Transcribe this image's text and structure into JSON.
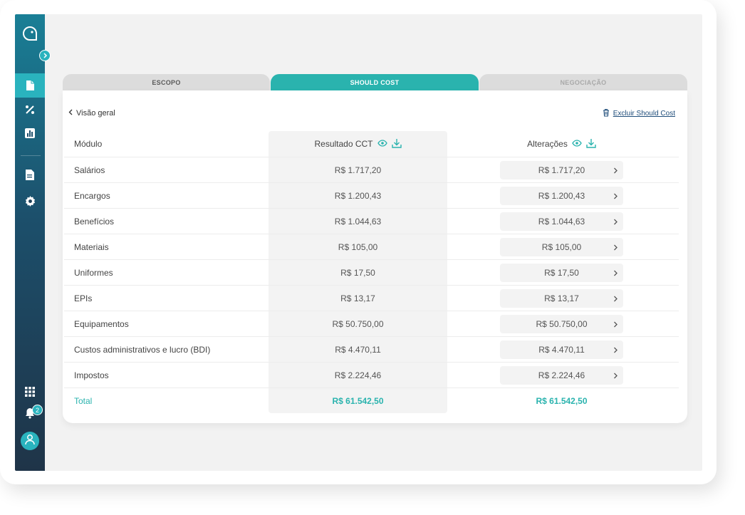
{
  "sidebar": {
    "notification_count": "2"
  },
  "tabs": [
    {
      "label": "ESCOPO"
    },
    {
      "label": "SHOULD COST"
    },
    {
      "label": "NEGOCIAÇÃO"
    }
  ],
  "nav": {
    "back_label": "Visão geral",
    "delete_label": "Excluir Should Cost"
  },
  "table": {
    "headers": {
      "module": "Módulo",
      "cct": "Resultado CCT",
      "changes": "Alterações"
    },
    "rows": [
      {
        "module": "Salários",
        "cct": "R$ 1.717,20",
        "changes": "R$ 1.717,20"
      },
      {
        "module": "Encargos",
        "cct": "R$ 1.200,43",
        "changes": "R$ 1.200,43"
      },
      {
        "module": "Benefícios",
        "cct": "R$ 1.044,63",
        "changes": "R$ 1.044,63"
      },
      {
        "module": "Materiais",
        "cct": "R$ 105,00",
        "changes": "R$ 105,00"
      },
      {
        "module": "Uniformes",
        "cct": "R$ 17,50",
        "changes": "R$ 17,50"
      },
      {
        "module": "EPIs",
        "cct": "R$ 13,17",
        "changes": "R$ 13,17"
      },
      {
        "module": "Equipamentos",
        "cct": "R$ 50.750,00",
        "changes": "R$ 50.750,00"
      },
      {
        "module": "Custos administrativos e lucro (BDI)",
        "cct": "R$ 4.470,11",
        "changes": "R$ 4.470,11"
      },
      {
        "module": "Impostos",
        "cct": "R$ 2.224,46",
        "changes": "R$ 2.224,46"
      }
    ],
    "total": {
      "label": "Total",
      "cct": "R$ 61.542,50",
      "changes": "R$ 61.542,50"
    }
  },
  "colors": {
    "accent": "#2ab3ae",
    "sidebar_top": "#1a7f96",
    "sidebar_bottom": "#1f3448",
    "link": "#1f4d7a"
  },
  "icons": {
    "logo": "speech-bubble-logo-icon",
    "expand": "chevron-right-icon",
    "document": "document-icon",
    "percent": "percent-icon",
    "chart": "bar-chart-icon",
    "report": "report-icon",
    "settings": "gear-icon",
    "apps": "grid-icon",
    "notifications": "bell-icon",
    "user": "user-icon",
    "view": "eye-icon",
    "download": "download-icon",
    "trash": "trash-icon",
    "back": "chevron-left-icon",
    "row_open": "chevron-right-icon"
  }
}
